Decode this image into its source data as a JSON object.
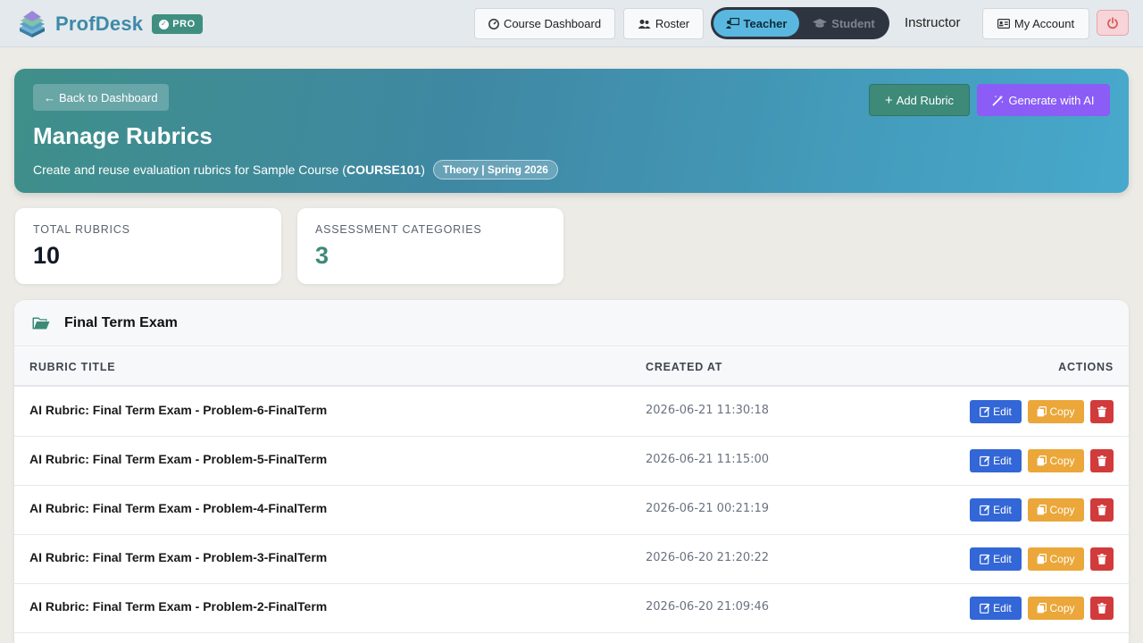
{
  "nav": {
    "brand": "ProfDesk",
    "badge": "PRO",
    "course_dashboard": "Course Dashboard",
    "roster": "Roster",
    "role_teacher": "Teacher",
    "role_student": "Student",
    "active_role": "Teacher",
    "user_label": "Instructor",
    "my_account": "My Account"
  },
  "hero": {
    "back_label": "Back to Dashboard",
    "title": "Manage Rubrics",
    "subtitle_prefix": "Create and reuse evaluation rubrics for Sample Course (",
    "course_code": "COURSE101",
    "subtitle_suffix": ")",
    "term": "Theory | Spring 2026",
    "add_rubric": "Add Rubric",
    "generate_ai": "Generate with AI"
  },
  "stats": [
    {
      "label": "TOTAL RUBRICS",
      "value": "10",
      "color": "#111827"
    },
    {
      "label": "ASSESSMENT CATEGORIES",
      "value": "3",
      "color": "#3d8a79"
    }
  ],
  "section": {
    "title": "Final Term Exam",
    "columns": {
      "title": "RUBRIC TITLE",
      "created": "CREATED AT",
      "actions": "ACTIONS"
    },
    "action_labels": {
      "edit": "Edit",
      "copy": "Copy"
    },
    "rows": [
      {
        "title": "AI Rubric: Final Term Exam - Problem-6-FinalTerm",
        "created": "2026-06-21 11:30:18"
      },
      {
        "title": "AI Rubric: Final Term Exam - Problem-5-FinalTerm",
        "created": "2026-06-21 11:15:00"
      },
      {
        "title": "AI Rubric: Final Term Exam - Problem-4-FinalTerm",
        "created": "2026-06-21 00:21:19"
      },
      {
        "title": "AI Rubric: Final Term Exam - Problem-3-FinalTerm",
        "created": "2026-06-20 21:20:22"
      },
      {
        "title": "AI Rubric: Final Term Exam - Problem-2-FinalTerm",
        "created": "2026-06-20 21:09:46"
      }
    ]
  },
  "colors": {
    "brand": "#3d8aa8",
    "hero_start": "#3f8f8a",
    "hero_end": "#47a9cc",
    "edit": "#3366d6",
    "copy": "#eba739",
    "delete": "#d13b3b",
    "ai": "#8b5cf6"
  },
  "icons": {
    "logo": "book-stack-logo",
    "course_dashboard": "gauge-icon",
    "roster": "users-icon",
    "teacher": "chalkboard-teacher-icon",
    "student": "graduation-cap-icon",
    "account": "id-card-icon",
    "logout": "power-icon",
    "folder": "folder-open-icon"
  }
}
